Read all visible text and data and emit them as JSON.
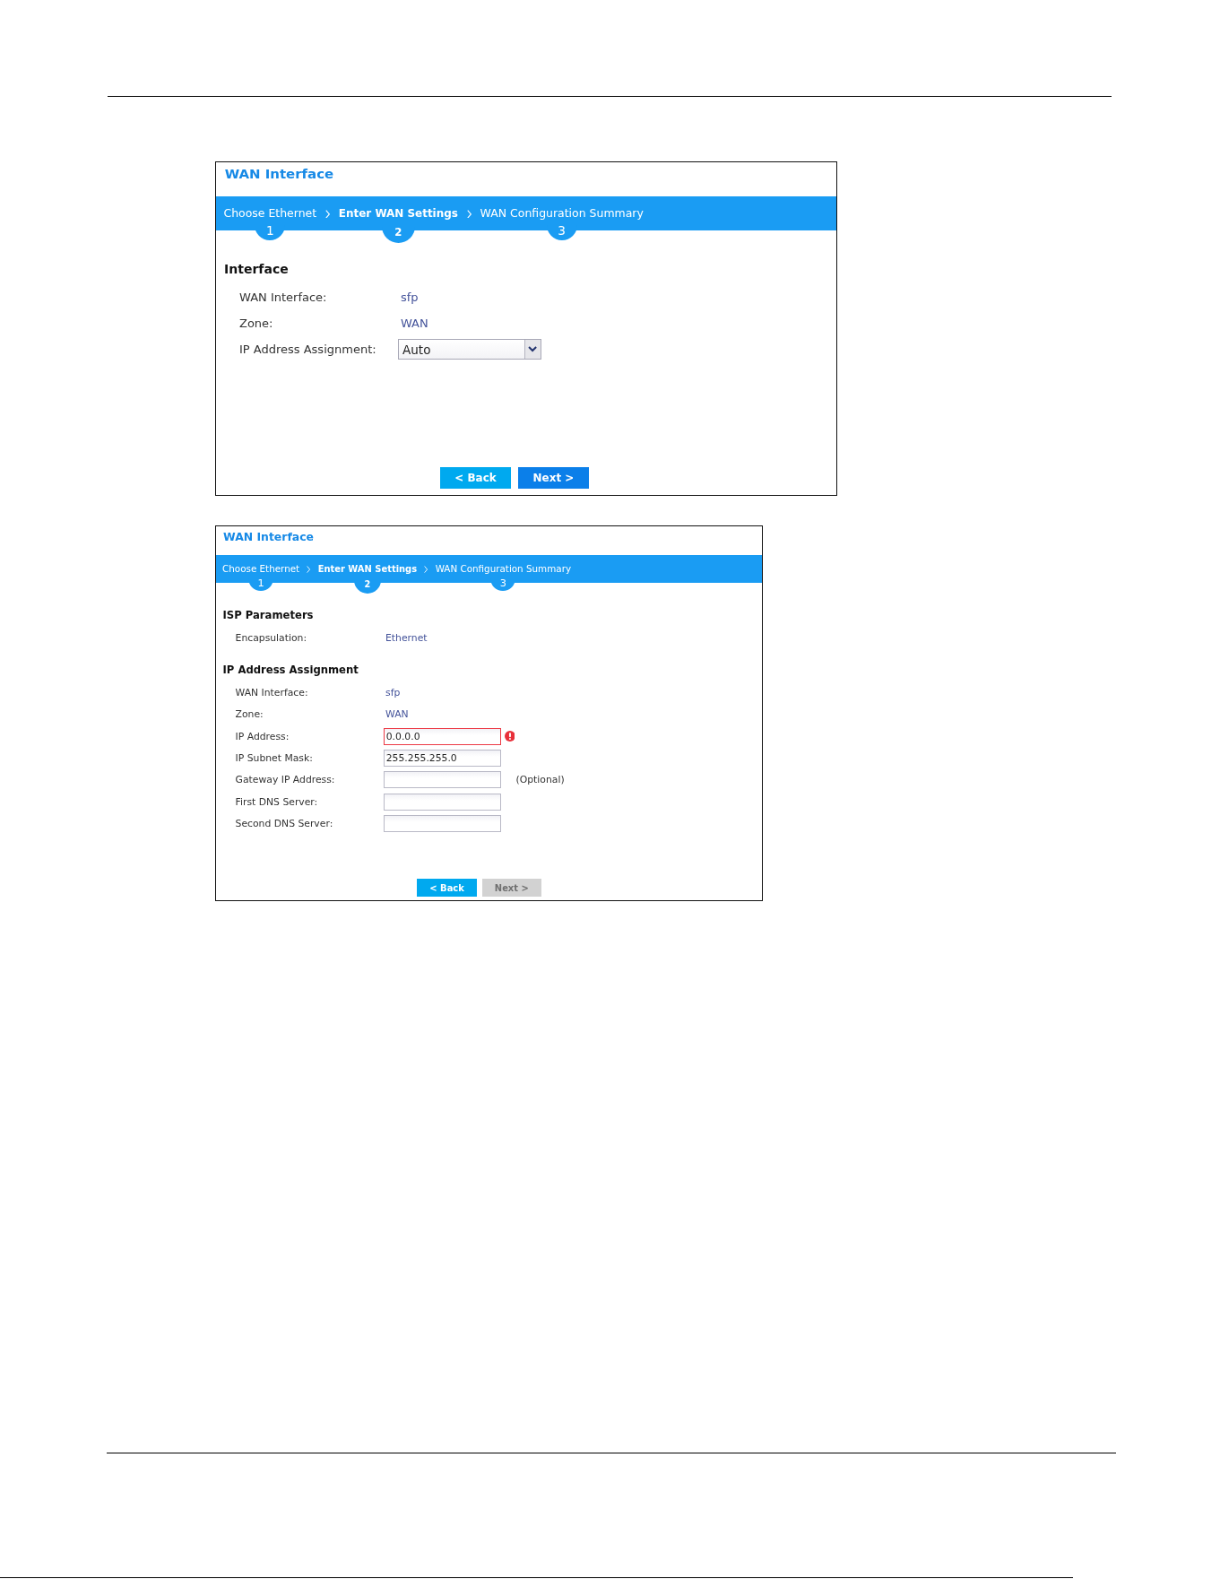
{
  "panels": [
    {
      "title": "WAN Interface",
      "steps": [
        {
          "label": "Choose Ethernet",
          "number": "1",
          "selected": false
        },
        {
          "label": "Enter WAN Settings",
          "number": "2",
          "selected": true
        },
        {
          "label": "WAN Configuration Summary",
          "number": "3",
          "selected": false
        }
      ],
      "sections": [
        {
          "heading": "Interface",
          "rows": [
            {
              "kind": "text",
              "label": "WAN Interface:",
              "value": "sfp"
            },
            {
              "kind": "text",
              "label": "Zone:",
              "value": "WAN"
            },
            {
              "kind": "select",
              "label": "IP Address Assignment:",
              "value": "Auto"
            }
          ]
        }
      ],
      "buttons": [
        {
          "kind": "back",
          "label": "< Back",
          "disabled": false
        },
        {
          "kind": "next",
          "label": "Next >",
          "disabled": false
        }
      ]
    },
    {
      "title": "WAN Interface",
      "steps": [
        {
          "label": "Choose Ethernet",
          "number": "1",
          "selected": false
        },
        {
          "label": "Enter WAN Settings",
          "number": "2",
          "selected": true
        },
        {
          "label": "WAN Configuration Summary",
          "number": "3",
          "selected": false
        }
      ],
      "sections": [
        {
          "heading": "ISP Parameters",
          "rows": [
            {
              "kind": "text",
              "label": "Encapsulation:",
              "value": "Ethernet"
            }
          ]
        },
        {
          "heading": "IP Address Assignment",
          "rows": [
            {
              "kind": "text",
              "label": "WAN Interface:",
              "value": "sfp"
            },
            {
              "kind": "text",
              "label": "Zone:",
              "value": "WAN"
            },
            {
              "kind": "input",
              "label": "IP Address:",
              "value": "0.0.0.0",
              "error": true
            },
            {
              "kind": "input",
              "label": "IP Subnet Mask:",
              "value": "255.255.255.0",
              "error": false
            },
            {
              "kind": "input",
              "label": "Gateway IP Address:",
              "error": false,
              "note": "(Optional)"
            },
            {
              "kind": "input",
              "label": "First DNS Server:",
              "error": false
            },
            {
              "kind": "input",
              "label": "Second DNS Server:",
              "error": false
            }
          ]
        }
      ],
      "buttons": [
        {
          "kind": "back",
          "label": "< Back",
          "disabled": false
        },
        {
          "kind": "next",
          "label": "Next >",
          "disabled": true
        }
      ]
    }
  ]
}
